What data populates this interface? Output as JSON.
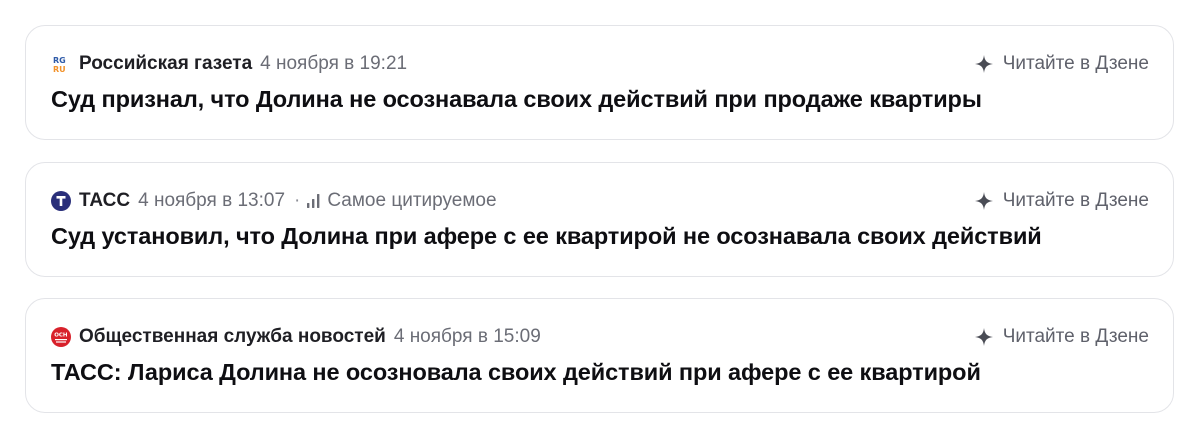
{
  "feed": {
    "items": [
      {
        "logo_icon": "rg-ru-logo-icon",
        "source": "Российская газета",
        "date": "4 ноября в 19:21",
        "cited_label": "",
        "read_label": "Читайте в Дзене",
        "headline": "Суд признал, что Долина не осознавала своих действий при продаже квартиры"
      },
      {
        "logo_icon": "tass-logo-icon",
        "source": "ТАСС",
        "date": "4 ноября в 13:07",
        "separator": "·",
        "cited_icon": "bar-chart-icon",
        "cited_label": "Самое цитируемое",
        "read_label": "Читайте в Дзене",
        "headline": "Суд установил, что Долина при афере с ее квартирой не осознавала своих действий"
      },
      {
        "logo_icon": "osn-logo-icon",
        "source": "Общественная служба новостей",
        "date": "4 ноября в 15:09",
        "cited_label": "",
        "read_label": "Читайте в Дзене",
        "headline": "ТАСС: Лариса Долина не осозновала своих действий при афере с ее квартирой"
      }
    ],
    "read_icon": "sparkle-icon",
    "colors": {
      "tass_logo": "#2a2f7a",
      "osn_logo": "#d8212b",
      "rg_logo_orange": "#f2922a",
      "rg_logo_blue": "#2d5aa8",
      "border": "#e3e4e8",
      "muted_text": "#6b6d76"
    }
  }
}
